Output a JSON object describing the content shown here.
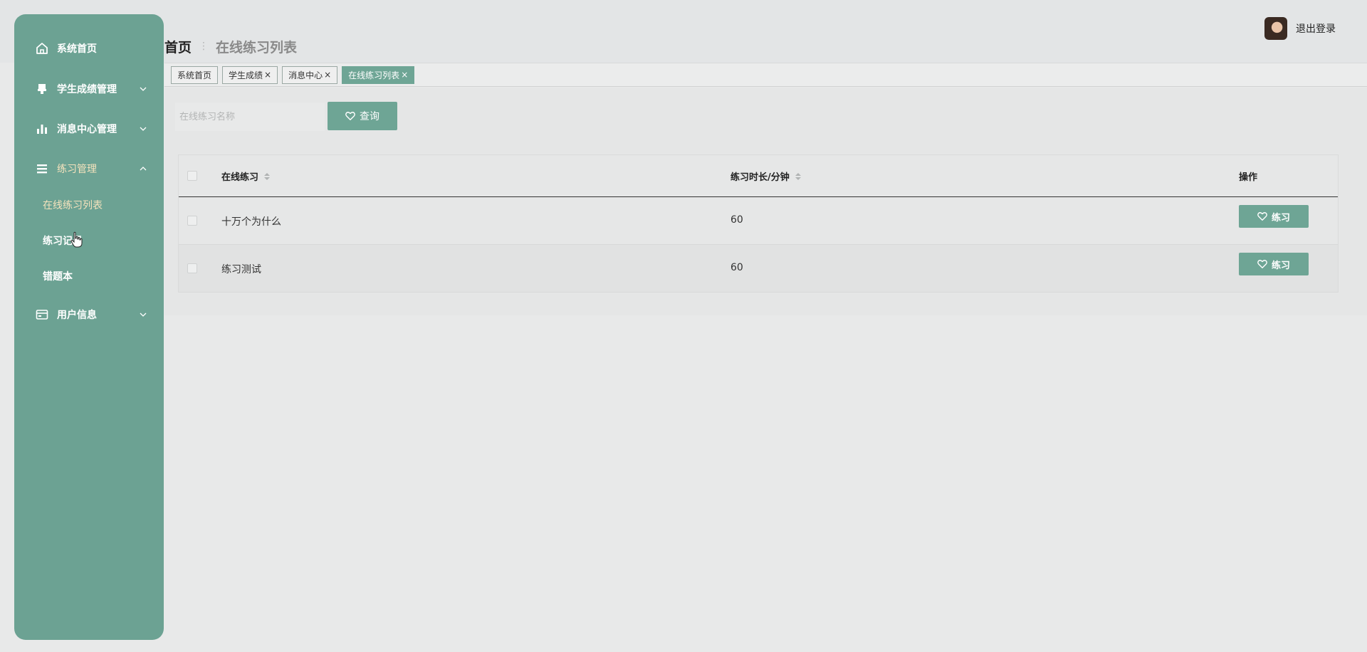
{
  "breadcrumb": {
    "home": "首页",
    "separator": "⋮",
    "current": "在线练习列表"
  },
  "header": {
    "logout": "退出登录"
  },
  "tabs": [
    {
      "label": "系统首页",
      "closable": false
    },
    {
      "label": "学生成绩",
      "closable": true
    },
    {
      "label": "消息中心",
      "closable": true
    },
    {
      "label": "在线练习列表",
      "closable": true,
      "active": true
    }
  ],
  "tab_close_glyph": "×",
  "sidebar": {
    "items": [
      {
        "label": "系统首页",
        "icon": "home-icon"
      },
      {
        "label": "学生成绩管理",
        "icon": "stamp-icon",
        "chevron": "down"
      },
      {
        "label": "消息中心管理",
        "icon": "bar-chart-icon",
        "chevron": "down"
      },
      {
        "label": "练习管理",
        "icon": "menu-icon",
        "chevron": "up",
        "open": true
      },
      {
        "label": "用户信息",
        "icon": "card-icon",
        "chevron": "down"
      }
    ],
    "sub_items": [
      {
        "label": "在线练习列表",
        "active": true
      },
      {
        "label": "练习记录"
      },
      {
        "label": "错题本"
      }
    ]
  },
  "search": {
    "placeholder": "在线练习名称",
    "value": "",
    "button_label": "查询",
    "button_icon": "heart-icon"
  },
  "table": {
    "columns": [
      "在线练习",
      "练习时长/分钟",
      "操作"
    ],
    "rows": [
      {
        "name": "十万个为什么",
        "duration": "60",
        "action": "练习"
      },
      {
        "name": "练习测试",
        "duration": "60",
        "action": "练习"
      }
    ]
  },
  "colors": {
    "accent": "#6ea595",
    "sidebar": "#6ca293",
    "active_text": "#f5e3bd"
  }
}
